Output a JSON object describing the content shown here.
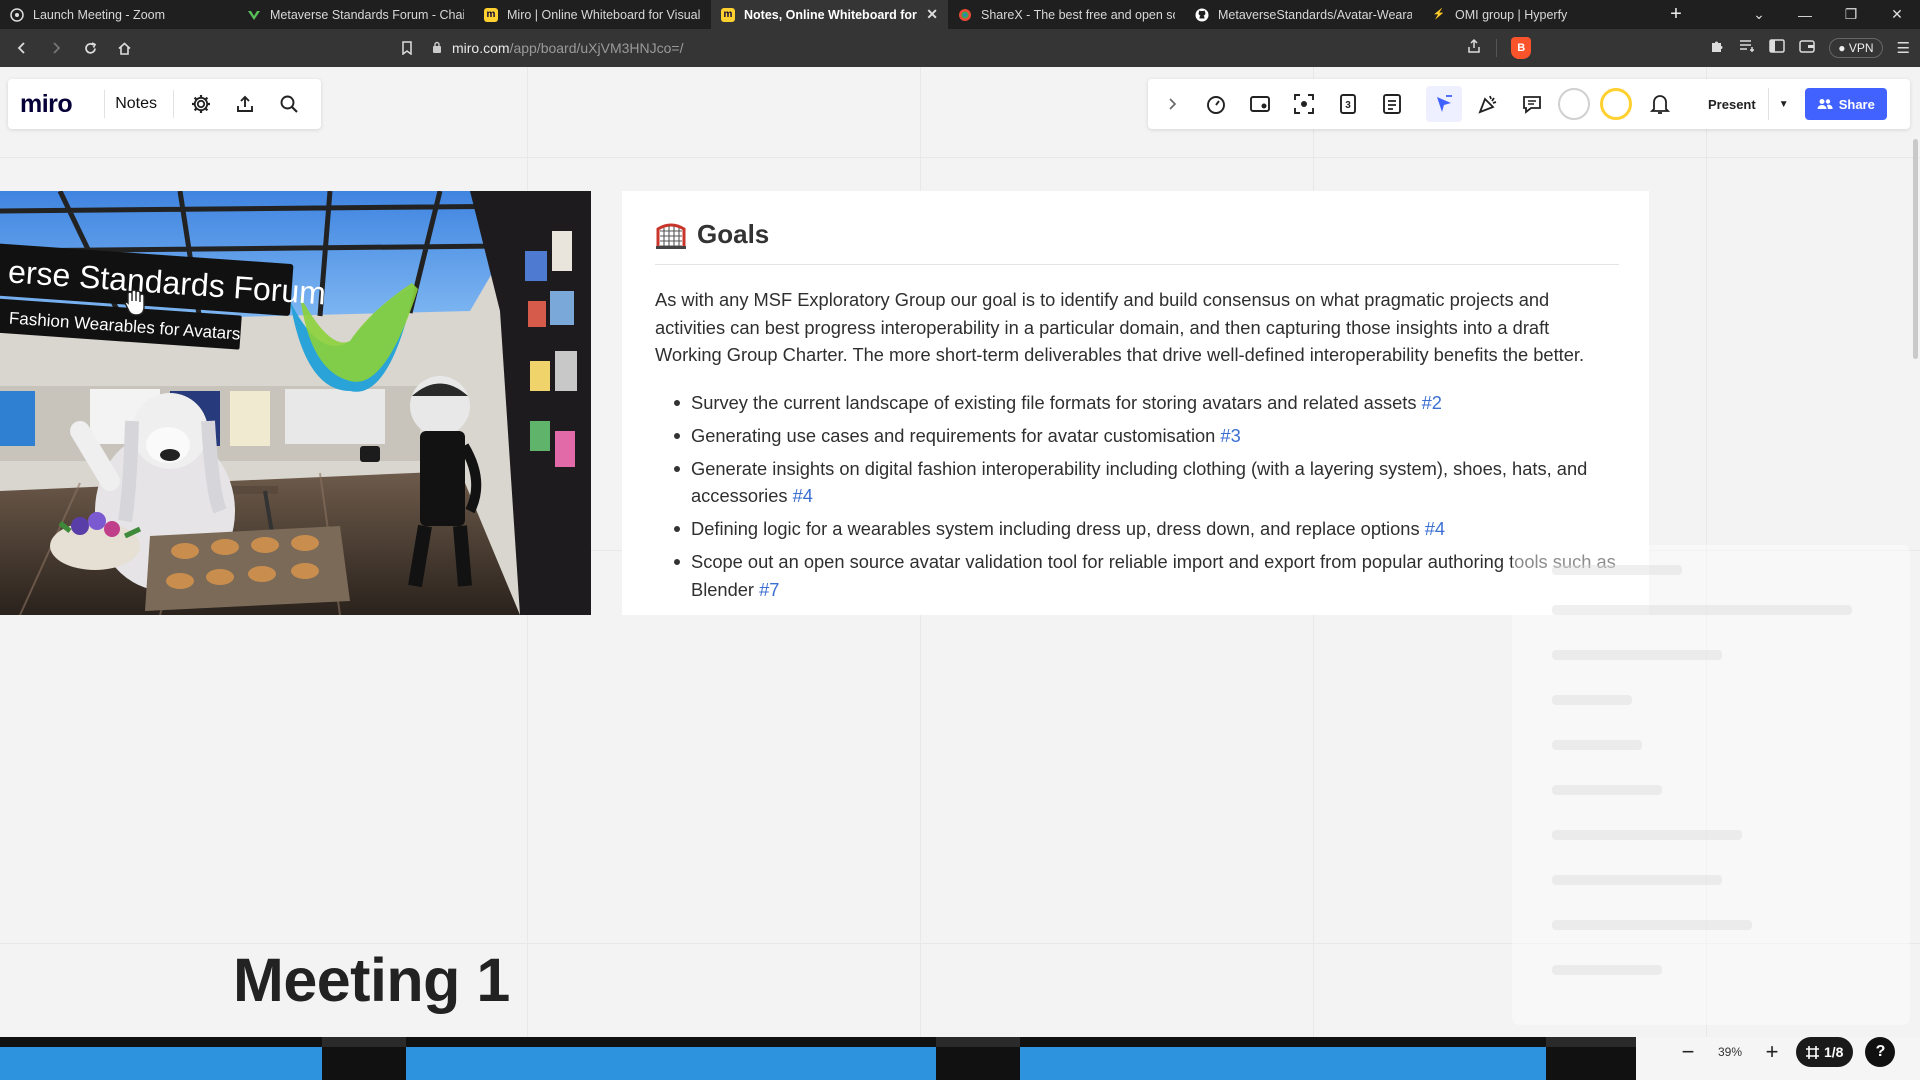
{
  "browser": {
    "tabs": [
      {
        "title": "Launch Meeting - Zoom",
        "fav": "zoom",
        "color": "#2d8cff"
      },
      {
        "title": "Metaverse Standards Forum - Chairs",
        "fav": "msf",
        "color": "#59c15a"
      },
      {
        "title": "Miro | Online Whiteboard for Visual C",
        "fav": "miro",
        "color": "#ffd02f"
      },
      {
        "title": "Notes, Online Whiteboard for Vi",
        "fav": "miro",
        "color": "#ffd02f",
        "active": true
      },
      {
        "title": "ShareX - The best free and open sou",
        "fav": "sharex",
        "color": "#e94b35"
      },
      {
        "title": "MetaverseStandards/Avatar-Wearab",
        "fav": "github",
        "color": "#ffffff"
      },
      {
        "title": "OMI group | Hyperfy",
        "fav": "hyperfy",
        "color": "#ffffff"
      }
    ],
    "url_host": "miro.com",
    "url_path": "/app/board/uXjVM3HNJco=/",
    "vpn_label": "VPN"
  },
  "miro": {
    "logo": "miro",
    "board_name": "Notes",
    "present_label": "Present",
    "share_label": "Share",
    "zoom": "39%",
    "frames": "1/8",
    "help": "?"
  },
  "scene": {
    "banner_line1": "erse Standards Forum",
    "banner_line2": "Fashion Wearables for Avatars"
  },
  "goals": {
    "title": "Goals",
    "paragraph": "As with any MSF Exploratory Group our goal is to identify and build consensus on what pragmatic projects and activities can best progress interoperability in a particular domain, and then capturing those insights into a draft Working Group Charter. The more short-term deliverables that drive well-defined interoperability benefits the better.",
    "items": [
      {
        "text": "Survey the current landscape of existing file formats for storing avatars and related assets ",
        "link": "#2"
      },
      {
        "text": "Generating use cases and requirements for avatar customisation ",
        "link": "#3"
      },
      {
        "text": "Generate insights on digital fashion interoperability including clothing (with a layering system), shoes, hats, and accessories ",
        "link": "#4"
      },
      {
        "text": "Defining logic for a wearables system including dress up, dress down, and replace options ",
        "link": "#4"
      },
      {
        "text": "Scope out an open source avatar validation tool for reliable import and export from popular authoring tools such as Blender ",
        "link": "#7"
      }
    ]
  },
  "meeting": {
    "title": "Meeting 1"
  },
  "colors": {
    "miro_blue": "#4262ff",
    "link_blue": "#3a6fd1"
  }
}
